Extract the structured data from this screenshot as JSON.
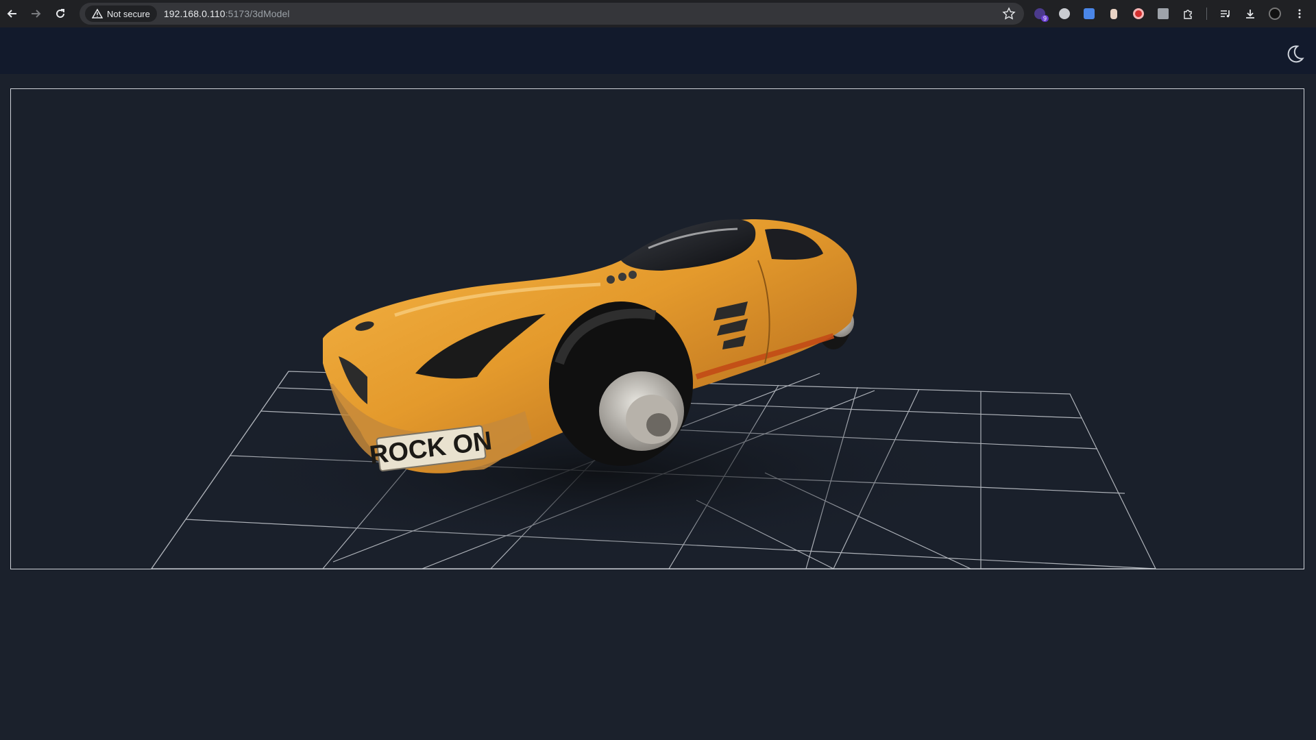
{
  "browser": {
    "security_label": "Not secure",
    "url_host": "192.168.0.110",
    "url_path": ":5173/3dModel",
    "extension_badge": "9"
  },
  "icons": {
    "back": "arrow-left-icon",
    "forward": "arrow-right-icon",
    "reload": "reload-icon",
    "security": "warning-triangle-icon",
    "bookmark": "star-icon",
    "theme": "moon-icon",
    "downloads": "download-icon",
    "menu": "kebab-menu-icon"
  },
  "viewer": {
    "model": {
      "plate_text": "ROCK ON",
      "body_color": "#e49a2c"
    },
    "grid_color": "#c8ccd2"
  },
  "colors": {
    "page_background": "#1b212c",
    "header_background": "#121a2c",
    "browser_chrome": "#202124"
  }
}
